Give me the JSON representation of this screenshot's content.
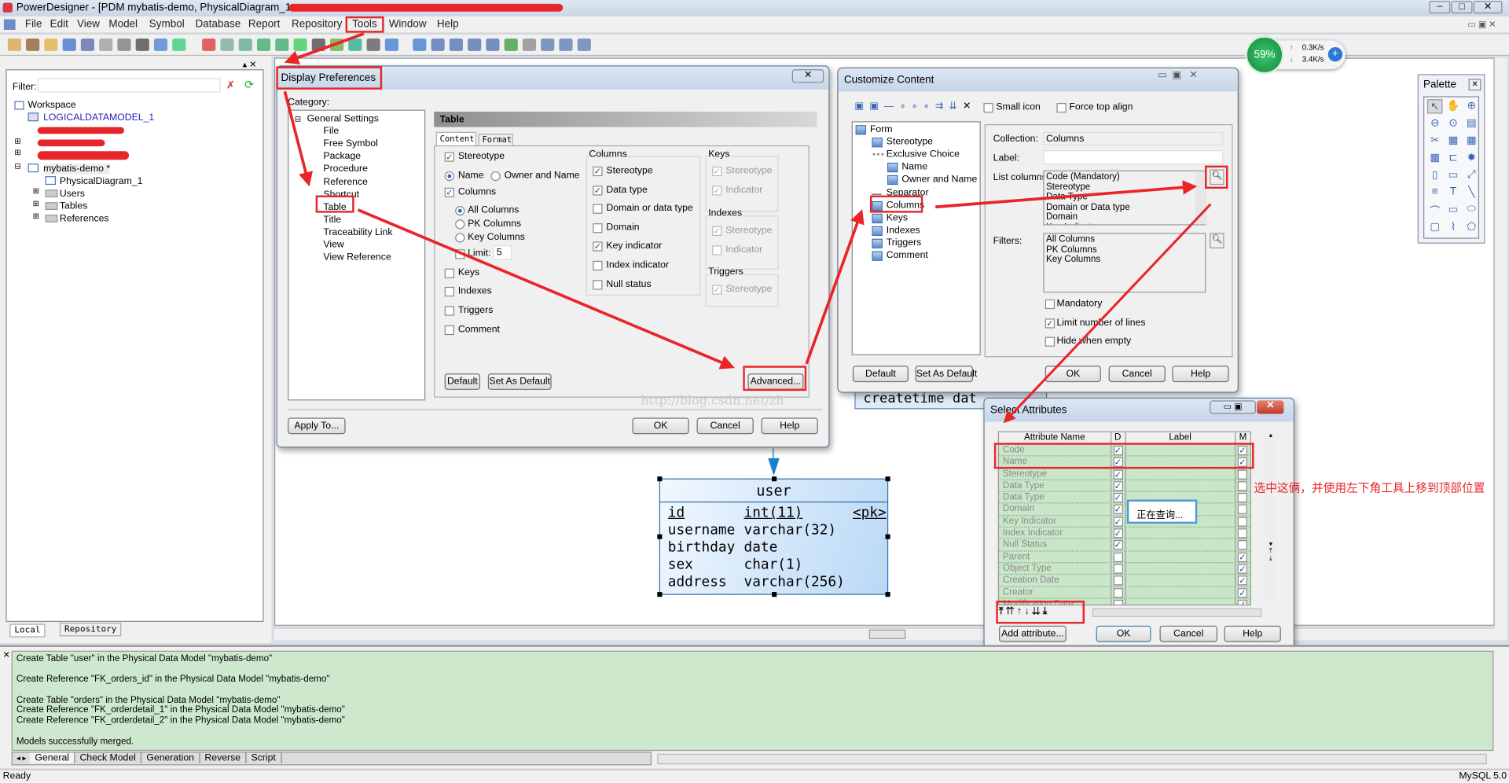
{
  "app": {
    "title": "PowerDesigner - [PDM mybatis-demo, PhysicalDiagram_1 - ",
    "menu": [
      "File",
      "Edit",
      "View",
      "Model",
      "Symbol",
      "Database",
      "Report",
      "Repository",
      "Tools",
      "Window",
      "Help"
    ],
    "highlighted_menu": "Tools"
  },
  "browser": {
    "filter_label": "Filter:",
    "filter_value": "",
    "tree": [
      "Workspace",
      "LOGICALDATAMODEL_1",
      "mybatis-demo *",
      "PhysicalDiagram_1",
      "Users",
      "Tables",
      "References"
    ],
    "tabs": [
      "Local",
      "Repository"
    ]
  },
  "network_widget": {
    "percent": "59%",
    "up": "0.3K/s",
    "down": "3.4K/s"
  },
  "display_prefs": {
    "title": "Display Preferences",
    "category_label": "Category:",
    "categories": [
      "General Settings",
      "File",
      "Free Symbol",
      "Package",
      "Procedure",
      "Reference",
      "Shortcut",
      "Table",
      "Title",
      "Traceability Link",
      "View",
      "View Reference"
    ],
    "selected_category": "Table",
    "panel_title": "Table",
    "tabs": [
      "Content",
      "Format"
    ],
    "active_tab": "Content",
    "left": {
      "stereotype": {
        "label": "Stereotype",
        "checked": true
      },
      "name": {
        "label": "Name",
        "selected": true
      },
      "owner_name": {
        "label": "Owner and Name",
        "selected": false
      },
      "columns": {
        "label": "Columns",
        "checked": true
      },
      "all_columns": {
        "label": "All Columns",
        "selected": true
      },
      "pk_columns": {
        "label": "PK Columns",
        "selected": false
      },
      "key_columns": {
        "label": "Key Columns",
        "selected": false
      },
      "limit": {
        "label": "Limit:",
        "checked": false,
        "value": "5"
      },
      "keys": {
        "label": "Keys",
        "checked": false
      },
      "indexes": {
        "label": "Indexes",
        "checked": false
      },
      "triggers": {
        "label": "Triggers",
        "checked": false
      },
      "comment": {
        "label": "Comment",
        "checked": false
      }
    },
    "columns_group": {
      "title": "Columns",
      "items": [
        {
          "label": "Stereotype",
          "checked": true
        },
        {
          "label": "Data type",
          "checked": true
        },
        {
          "label": "Domain or data type",
          "checked": false
        },
        {
          "label": "Domain",
          "checked": false
        },
        {
          "label": "Key indicator",
          "checked": true
        },
        {
          "label": "Index indicator",
          "checked": false
        },
        {
          "label": "Null status",
          "checked": false
        }
      ]
    },
    "keys_group": {
      "title": "Keys",
      "items": [
        {
          "label": "Stereotype",
          "checked": true
        },
        {
          "label": "Indicator",
          "checked": true
        }
      ]
    },
    "indexes_group": {
      "title": "Indexes",
      "items": [
        {
          "label": "Stereotype",
          "checked": true
        },
        {
          "label": "Indicator",
          "checked": false
        }
      ]
    },
    "triggers_group": {
      "title": "Triggers",
      "items": [
        {
          "label": "Stereotype",
          "checked": true
        }
      ]
    },
    "buttons": {
      "default": "Default",
      "set_default": "Set As Default",
      "advanced": "Advanced...",
      "apply_to": "Apply To...",
      "ok": "OK",
      "cancel": "Cancel",
      "help": "Help"
    },
    "watermark": "http://blog.csdn.net/zh"
  },
  "customize": {
    "title": "Customize Content",
    "small_icon": {
      "label": "Small icon",
      "checked": false
    },
    "force_top": {
      "label": "Force top align",
      "checked": false
    },
    "tree": [
      "Form",
      "Stereotype",
      "Exclusive Choice",
      "Name",
      "Owner and Name",
      "Separator",
      "Columns",
      "Keys",
      "Indexes",
      "Triggers",
      "Comment"
    ],
    "selected": "Columns",
    "collection_label": "Collection:",
    "collection_value": "Columns",
    "label_label": "Label:",
    "label_value": "",
    "list_columns_label": "List columns:",
    "list_columns": [
      "Code (Mandatory)",
      "Stereotype",
      "Data Type",
      "Domain or Data type",
      "Domain",
      "Key Indicator"
    ],
    "filters_label": "Filters:",
    "filters": [
      "All Columns",
      "PK Columns",
      "Key Columns"
    ],
    "mandatory": {
      "label": "Mandatory",
      "checked": false
    },
    "limit_lines": {
      "label": "Limit number of lines",
      "checked": true
    },
    "hide_empty": {
      "label": "Hide when empty",
      "checked": false
    },
    "buttons": {
      "default": "Default",
      "set_default": "Set As Default",
      "ok": "OK",
      "cancel": "Cancel",
      "help": "Help"
    }
  },
  "background_text": "createtime dat",
  "select_attributes": {
    "title": "Select Attributes",
    "headers": [
      "Attribute Name",
      "D",
      "Label",
      "M"
    ],
    "rows": [
      {
        "name": "Code",
        "d": true,
        "m": true
      },
      {
        "name": "Name",
        "d": true,
        "m": true
      },
      {
        "name": "Stereotype",
        "d": true,
        "m": false
      },
      {
        "name": "Data Type",
        "d": true,
        "m": false
      },
      {
        "name": "Data Type",
        "d": true,
        "m": false
      },
      {
        "name": "Domain",
        "d": true,
        "m": false
      },
      {
        "name": "Key Indicator",
        "d": true,
        "m": false
      },
      {
        "name": "Index Indicator",
        "d": true,
        "m": false
      },
      {
        "name": "Null Status",
        "d": true,
        "m": false
      },
      {
        "name": "Parent",
        "d": false,
        "m": true
      },
      {
        "name": "Object Type",
        "d": false,
        "m": true
      },
      {
        "name": "Creation Date",
        "d": false,
        "m": true
      },
      {
        "name": "Creator",
        "d": false,
        "m": true
      },
      {
        "name": "Modification Date",
        "d": false,
        "m": true
      }
    ],
    "querying": "正在查询...",
    "buttons": {
      "add": "Add attribute...",
      "ok": "OK",
      "cancel": "Cancel",
      "help": "Help"
    },
    "move_tools": [
      "move-top",
      "move-page-up",
      "move-up",
      "move-down",
      "move-page-down",
      "move-bottom"
    ]
  },
  "annotation": "选中这俩，并使用左下角工具上移到顶部位置",
  "table_symbol": {
    "name": "user",
    "columns": [
      {
        "name": "id",
        "type": "int(11)",
        "key": "<pk>"
      },
      {
        "name": "username",
        "type": "varchar(32)",
        "key": ""
      },
      {
        "name": "birthday",
        "type": "date",
        "key": ""
      },
      {
        "name": "sex",
        "type": "char(1)",
        "key": ""
      },
      {
        "name": "address",
        "type": "varchar(256)",
        "key": ""
      }
    ]
  },
  "palette": {
    "title": "Palette"
  },
  "output": {
    "lines": [
      "Create Table \"user\" in the Physical Data Model \"mybatis-demo\"",
      "",
      "Create Reference \"FK_orders_id\" in the Physical Data Model \"mybatis-demo\"",
      "",
      "Create Table \"orders\" in the Physical Data Model \"mybatis-demo\"",
      "Create Reference \"FK_orderdetail_1\" in the Physical Data Model \"mybatis-demo\"",
      "Create Reference \"FK_orderdetail_2\" in the Physical Data Model \"mybatis-demo\"",
      "",
      "Models successfully merged."
    ],
    "tabs": [
      "General",
      "Check Model",
      "Generation",
      "Reverse",
      "Script"
    ]
  },
  "status": {
    "left": "Ready",
    "right": "MySQL 5.0"
  },
  "colors": {
    "annotation_red": "#e8262a",
    "output_bg": "#cde8cd",
    "grid_bg": "#c9e6c9",
    "table_fill": "#cfe4f8"
  }
}
